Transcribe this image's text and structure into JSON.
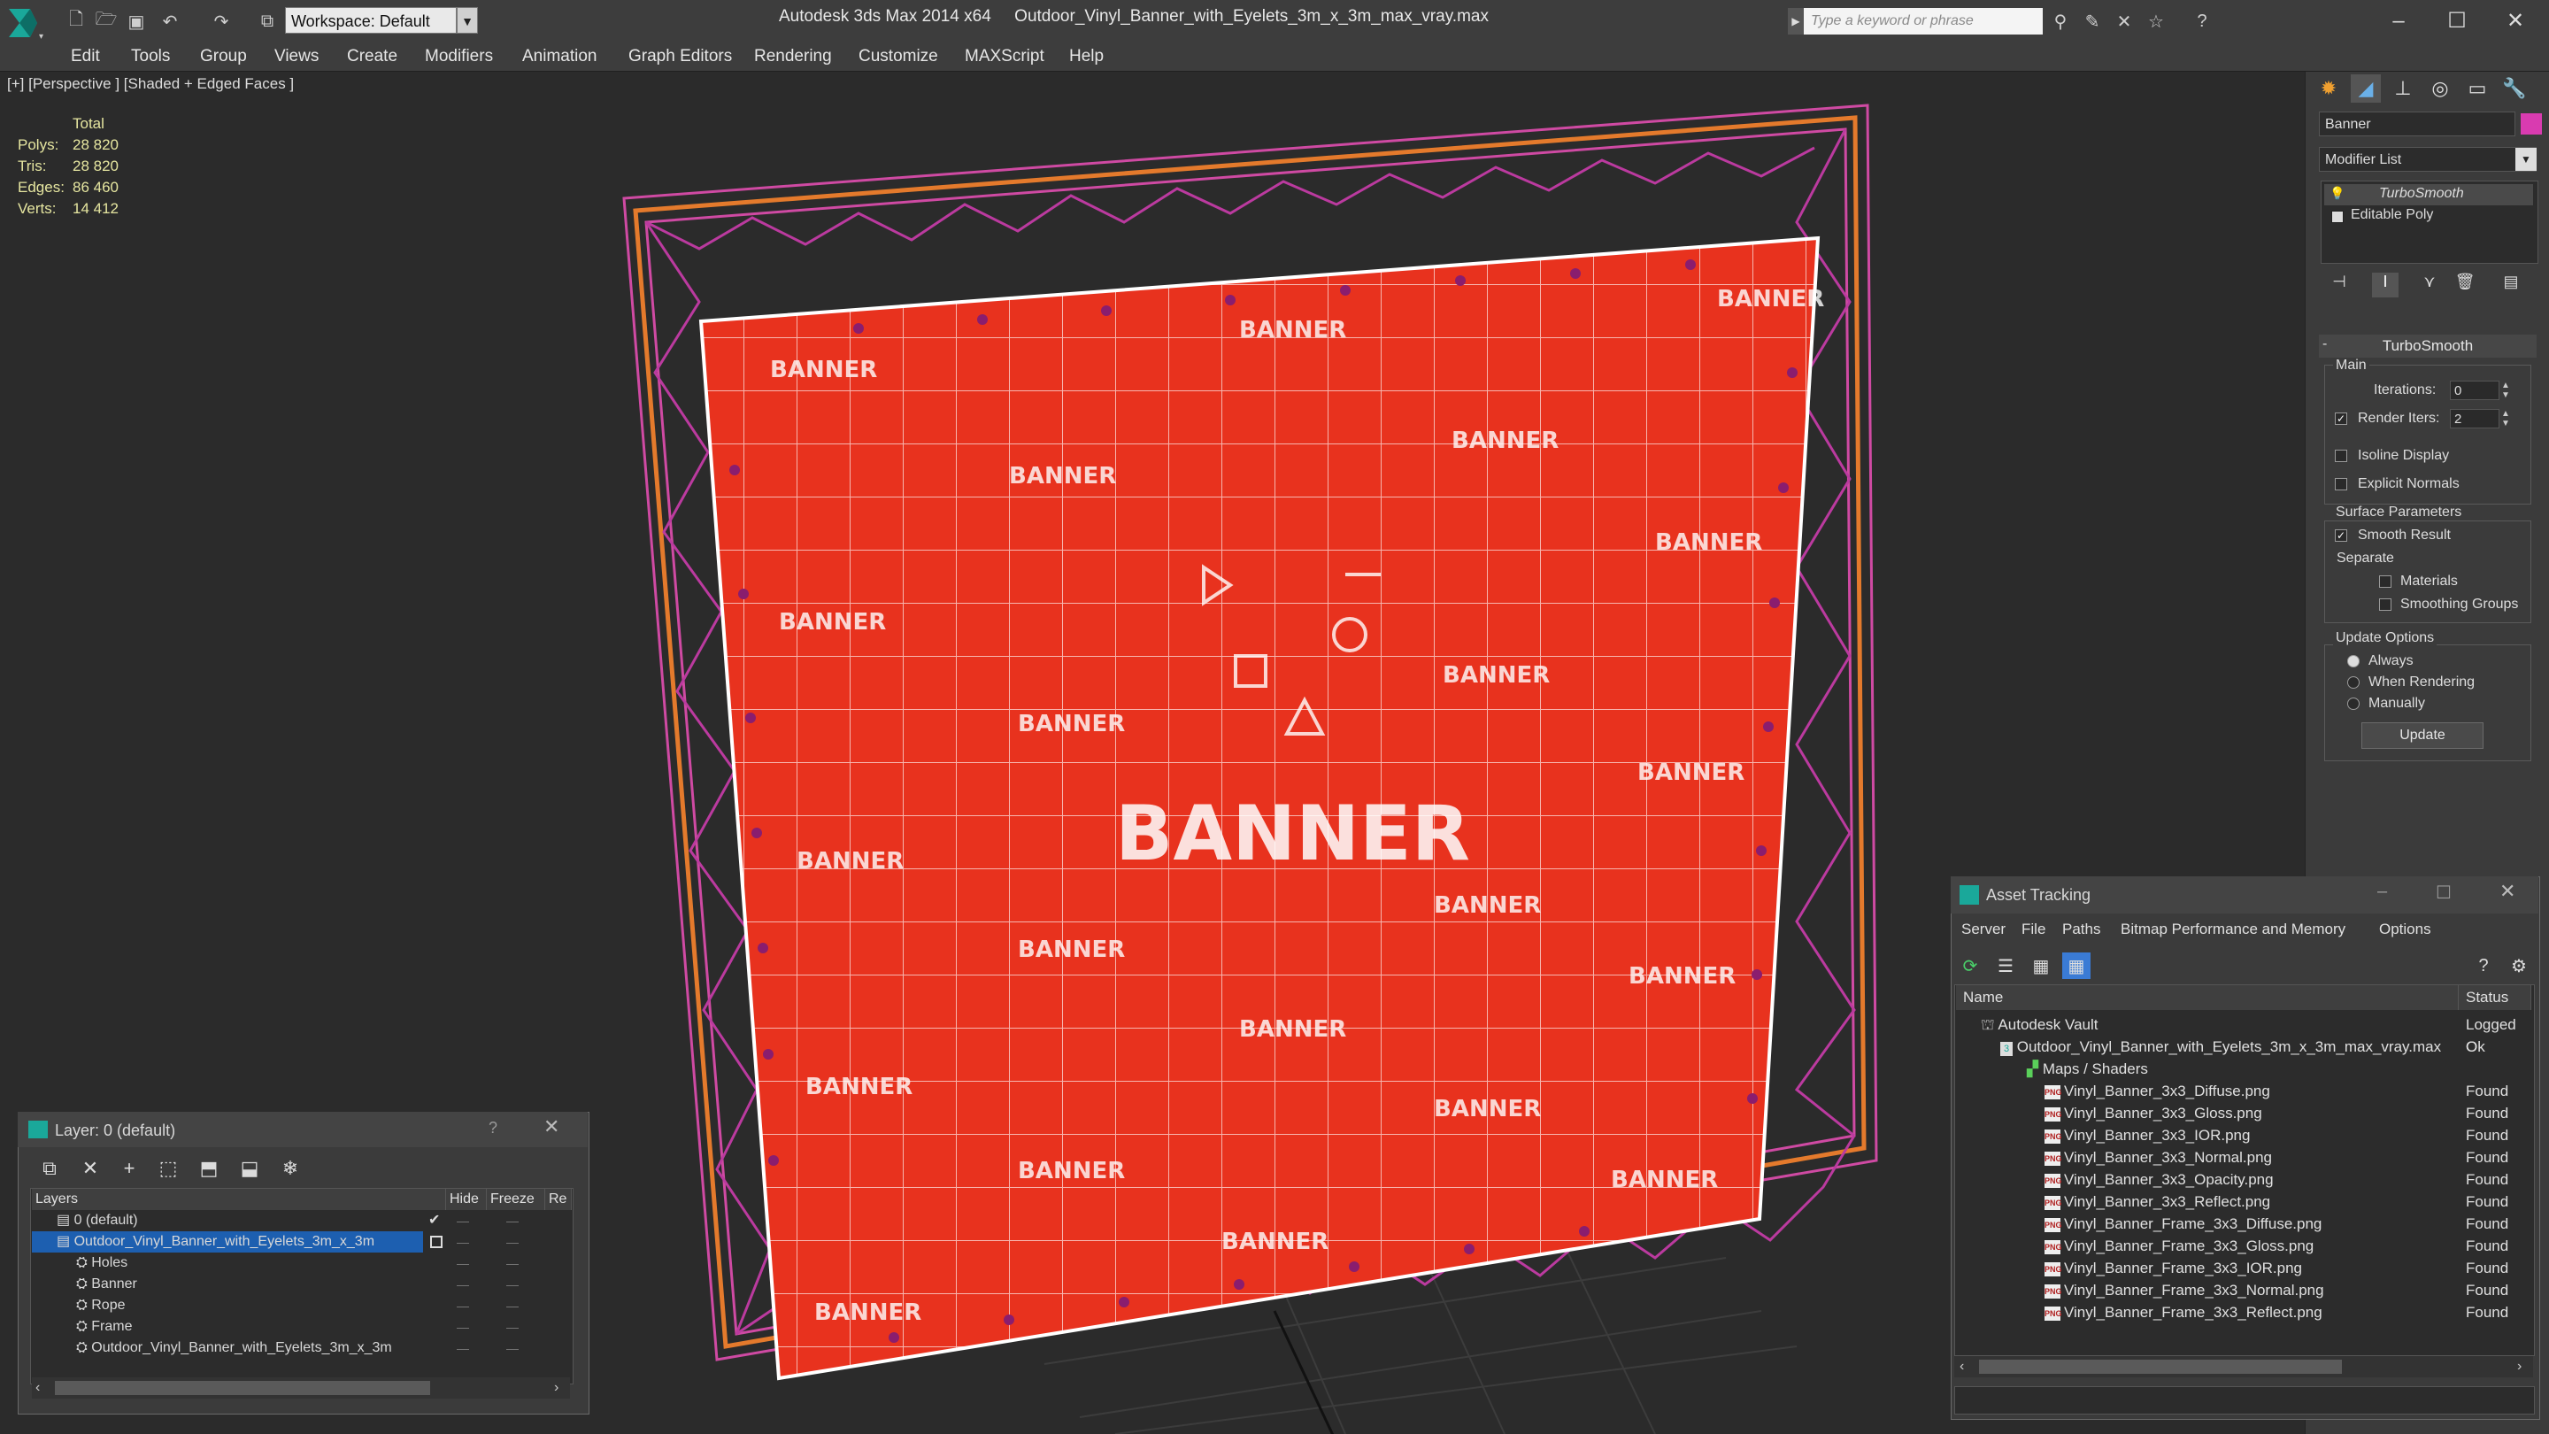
{
  "title_bar": {
    "workspace_label": "Workspace: Default",
    "app_title": "Autodesk 3ds Max  2014 x64",
    "file_name": "Outdoor_Vinyl_Banner_with_Eyelets_3m_x_3m_max_vray.max",
    "search_placeholder": "Type a keyword or phrase"
  },
  "menu": [
    "Edit",
    "Tools",
    "Group",
    "Views",
    "Create",
    "Modifiers",
    "Animation",
    "Graph Editors",
    "Rendering",
    "Customize",
    "MAXScript",
    "Help"
  ],
  "viewport": {
    "label": "[+] [Perspective ] [Shaded + Edged Faces ]",
    "stats_header": "Total",
    "stats": [
      {
        "label": "Polys:",
        "value": "28 820"
      },
      {
        "label": "Tris:",
        "value": "28 820"
      },
      {
        "label": "Edges:",
        "value": "86 460"
      },
      {
        "label": "Verts:",
        "value": "14 412"
      }
    ],
    "banner_center_text": "BANNER",
    "banner_small_text": "BANNER",
    "banner_color": "#e8321e"
  },
  "command_panel": {
    "object_name": "Banner",
    "object_color": "#d93bb0",
    "modifier_list_label": "Modifier List",
    "stack": [
      "TurboSmooth",
      "Editable Poly"
    ],
    "rollout_title": "TurboSmooth",
    "main_label": "Main",
    "iterations_label": "Iterations:",
    "iterations_value": "0",
    "render_iters_label": "Render Iters:",
    "render_iters_value": "2",
    "isoline_label": "Isoline Display",
    "explicit_normals_label": "Explicit Normals",
    "surface_params_label": "Surface Parameters",
    "smooth_result_label": "Smooth Result",
    "separate_label": "Separate",
    "materials_label": "Materials",
    "smoothing_groups_label": "Smoothing Groups",
    "update_options_label": "Update Options",
    "always_label": "Always",
    "when_rendering_label": "When Rendering",
    "manually_label": "Manually",
    "update_button": "Update"
  },
  "layer_dialog": {
    "title": "Layer: 0 (default)",
    "help": "?",
    "columns": [
      "Layers",
      "Hide",
      "Freeze",
      "Re"
    ],
    "rows": [
      {
        "name": "0 (default)",
        "indent": 0,
        "selected": false
      },
      {
        "name": "Outdoor_Vinyl_Banner_with_Eyelets_3m_x_3m",
        "indent": 0,
        "selected": true
      },
      {
        "name": "Holes",
        "indent": 1,
        "selected": false
      },
      {
        "name": "Banner",
        "indent": 1,
        "selected": false
      },
      {
        "name": "Rope",
        "indent": 1,
        "selected": false
      },
      {
        "name": "Frame",
        "indent": 1,
        "selected": false
      },
      {
        "name": "Outdoor_Vinyl_Banner_with_Eyelets_3m_x_3m",
        "indent": 1,
        "selected": false
      }
    ]
  },
  "asset_tracking": {
    "title": "Asset Tracking",
    "menu": [
      "Server",
      "File",
      "Paths",
      "Bitmap Performance and Memory",
      "Options"
    ],
    "columns": [
      "Name",
      "Status"
    ],
    "rows": [
      {
        "name": "Autodesk Vault",
        "status": "Logged O",
        "indent": 0,
        "type": "vault"
      },
      {
        "name": "Outdoor_Vinyl_Banner_with_Eyelets_3m_x_3m_max_vray.max",
        "status": "Ok",
        "indent": 1,
        "type": "max"
      },
      {
        "name": "Maps / Shaders",
        "status": "",
        "indent": 2,
        "type": "folder"
      },
      {
        "name": "Vinyl_Banner_3x3_Diffuse.png",
        "status": "Found",
        "indent": 3,
        "type": "png"
      },
      {
        "name": "Vinyl_Banner_3x3_Gloss.png",
        "status": "Found",
        "indent": 3,
        "type": "png"
      },
      {
        "name": "Vinyl_Banner_3x3_IOR.png",
        "status": "Found",
        "indent": 3,
        "type": "png"
      },
      {
        "name": "Vinyl_Banner_3x3_Normal.png",
        "status": "Found",
        "indent": 3,
        "type": "png"
      },
      {
        "name": "Vinyl_Banner_3x3_Opacity.png",
        "status": "Found",
        "indent": 3,
        "type": "png"
      },
      {
        "name": "Vinyl_Banner_3x3_Reflect.png",
        "status": "Found",
        "indent": 3,
        "type": "png"
      },
      {
        "name": "Vinyl_Banner_Frame_3x3_Diffuse.png",
        "status": "Found",
        "indent": 3,
        "type": "png"
      },
      {
        "name": "Vinyl_Banner_Frame_3x3_Gloss.png",
        "status": "Found",
        "indent": 3,
        "type": "png"
      },
      {
        "name": "Vinyl_Banner_Frame_3x3_IOR.png",
        "status": "Found",
        "indent": 3,
        "type": "png"
      },
      {
        "name": "Vinyl_Banner_Frame_3x3_Normal.png",
        "status": "Found",
        "indent": 3,
        "type": "png"
      },
      {
        "name": "Vinyl_Banner_Frame_3x3_Reflect.png",
        "status": "Found",
        "indent": 3,
        "type": "png"
      }
    ]
  }
}
